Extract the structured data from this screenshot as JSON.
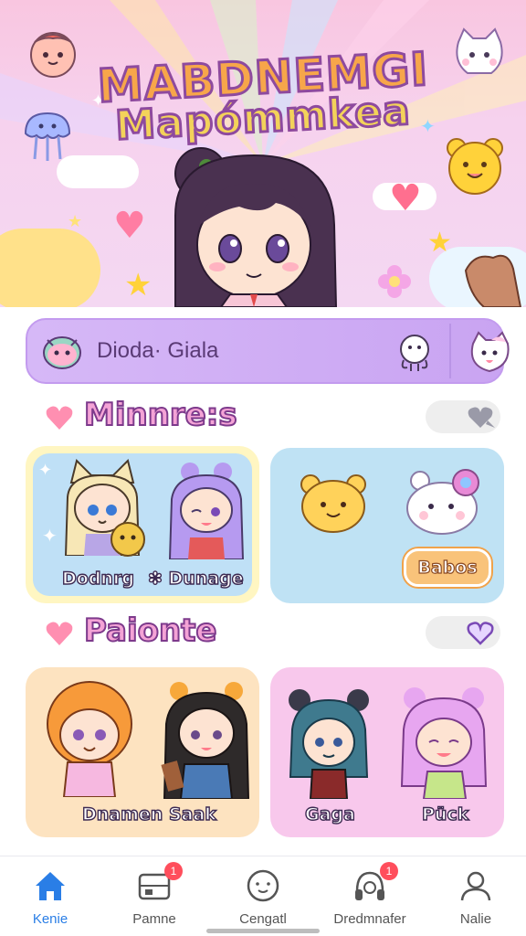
{
  "banner": {
    "title_line1": "MABDNEMGI",
    "title_line2": "Mapómmkea"
  },
  "search": {
    "text": "Dioda· Giala"
  },
  "sections": [
    {
      "title": "Minnre:s",
      "toggle_on": false,
      "cards": [
        {
          "labels": [
            "Dodnrg",
            "✽ Dunage"
          ]
        },
        {
          "button_label": "Babos"
        }
      ]
    },
    {
      "title": "Paionte",
      "toggle_on": true,
      "cards": [
        {
          "labels": [
            "Dnamen Saak"
          ]
        },
        {
          "labels": [
            "Gaga",
            "Pück"
          ]
        }
      ]
    }
  ],
  "nav": {
    "items": [
      {
        "label": "Kenie",
        "icon": "home-icon",
        "badge": ""
      },
      {
        "label": "Pamne",
        "icon": "gallery-icon",
        "badge": "1"
      },
      {
        "label": "Cengatl",
        "icon": "face-icon",
        "badge": ""
      },
      {
        "label": "Dredmnafer",
        "icon": "headphones-icon",
        "badge": "1"
      },
      {
        "label": "Nalie",
        "icon": "profile-icon",
        "badge": ""
      }
    ]
  },
  "colors": {
    "accent": "#2a7ee6",
    "pill": "#d6b8f7",
    "heart": "#ff8fb1",
    "badge": "#ff4e5c"
  }
}
